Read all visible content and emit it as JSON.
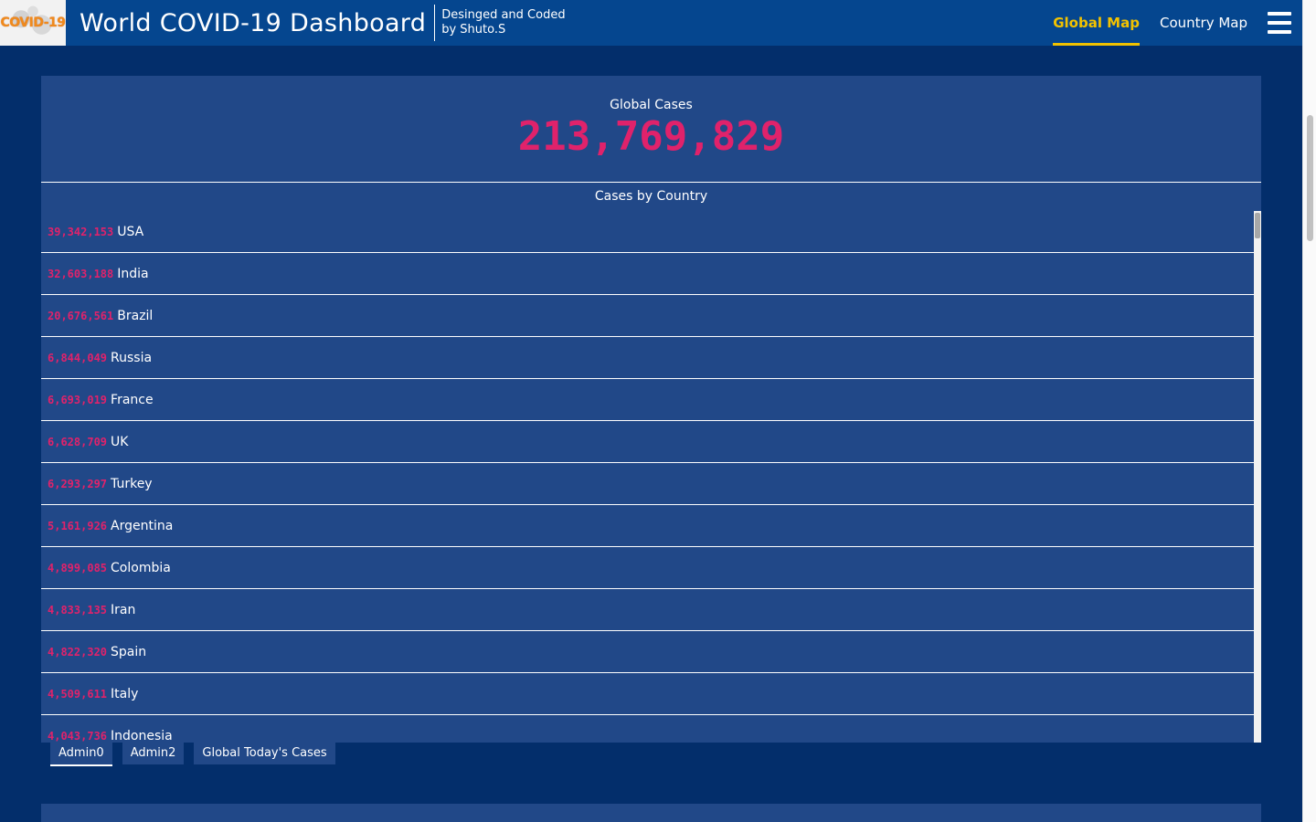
{
  "header": {
    "logo_text": "COVID-19",
    "title": "World COVID-19 Dashboard",
    "credit_line1": "Desinged and Coded",
    "credit_line2": "by Shuto.S",
    "nav": [
      {
        "label": "Global Map",
        "active": true
      },
      {
        "label": "Country Map",
        "active": false
      }
    ]
  },
  "global": {
    "label": "Global Cases",
    "value": "213,769,829"
  },
  "list": {
    "title": "Cases by Country",
    "rows": [
      {
        "cases": "39,342,153",
        "country": "USA"
      },
      {
        "cases": "32,603,188",
        "country": "India"
      },
      {
        "cases": "20,676,561",
        "country": "Brazil"
      },
      {
        "cases": "6,844,049",
        "country": "Russia"
      },
      {
        "cases": "6,693,019",
        "country": "France"
      },
      {
        "cases": "6,628,709",
        "country": "UK"
      },
      {
        "cases": "6,293,297",
        "country": "Turkey"
      },
      {
        "cases": "5,161,926",
        "country": "Argentina"
      },
      {
        "cases": "4,899,085",
        "country": "Colombia"
      },
      {
        "cases": "4,833,135",
        "country": "Iran"
      },
      {
        "cases": "4,822,320",
        "country": "Spain"
      },
      {
        "cases": "4,509,611",
        "country": "Italy"
      },
      {
        "cases": "4,043,736",
        "country": "Indonesia"
      }
    ]
  },
  "tabs": [
    {
      "label": "Admin0",
      "active": true
    },
    {
      "label": "Admin2",
      "active": false
    },
    {
      "label": "Global Today's Cases",
      "active": false
    }
  ],
  "colors": {
    "background": "#032e6b",
    "header": "#05468f",
    "panel": "#214888",
    "accent_number": "#e0226b",
    "active_nav": "#f2c200"
  },
  "icons": {
    "menu": "hamburger-menu-icon"
  }
}
